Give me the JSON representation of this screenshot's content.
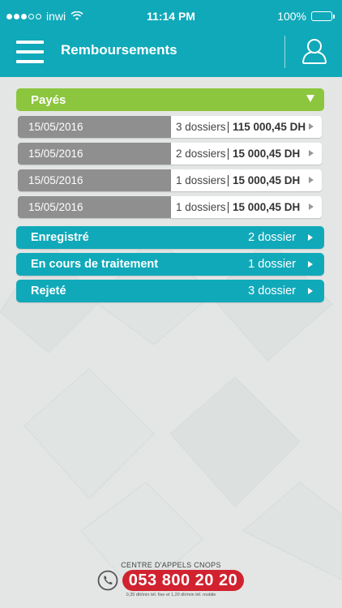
{
  "status_bar": {
    "carrier": "inwi",
    "time": "11:14 PM",
    "battery": "100%",
    "battery_level": 1.0,
    "signal_bars_filled": 3,
    "signal_bars_total": 5,
    "icons": [
      "signal-icon",
      "wifi-icon",
      "battery-icon"
    ]
  },
  "nav": {
    "title": "Remboursements",
    "icons": [
      "menu-icon",
      "user-profile-icon"
    ]
  },
  "paid_section": {
    "label": "Payés",
    "expanded": true,
    "rows": [
      {
        "date": "15/05/2016",
        "count": "3 dossiers",
        "amount": "115 000,45 DH"
      },
      {
        "date": "15/05/2016",
        "count": "2 dossiers",
        "amount": "15 000,45 DH"
      },
      {
        "date": "15/05/2016",
        "count": "1 dossiers",
        "amount": "15 000,45 DH"
      },
      {
        "date": "15/05/2016",
        "count": "1 dossiers",
        "amount": "15 000,45 DH"
      }
    ]
  },
  "status_sections": [
    {
      "label": "Enregistré",
      "count": "2 dossier"
    },
    {
      "label": "En cours de traitement",
      "count": "1 dossier"
    },
    {
      "label": "Rejeté",
      "count": "3 dossier"
    }
  ],
  "footer": {
    "title": "CENTRE D'APPELS CNOPS",
    "phone": "053 800 20 20",
    "rates": "0,35 dh/min tél. fixe et 1,20 dh/min tél. mobile"
  },
  "colors": {
    "primary": "#10a9b9",
    "accent_green": "#8cc63e",
    "date_gray": "#8f8f8f",
    "call_red": "#d1222f",
    "background": "#e3e6e5"
  }
}
